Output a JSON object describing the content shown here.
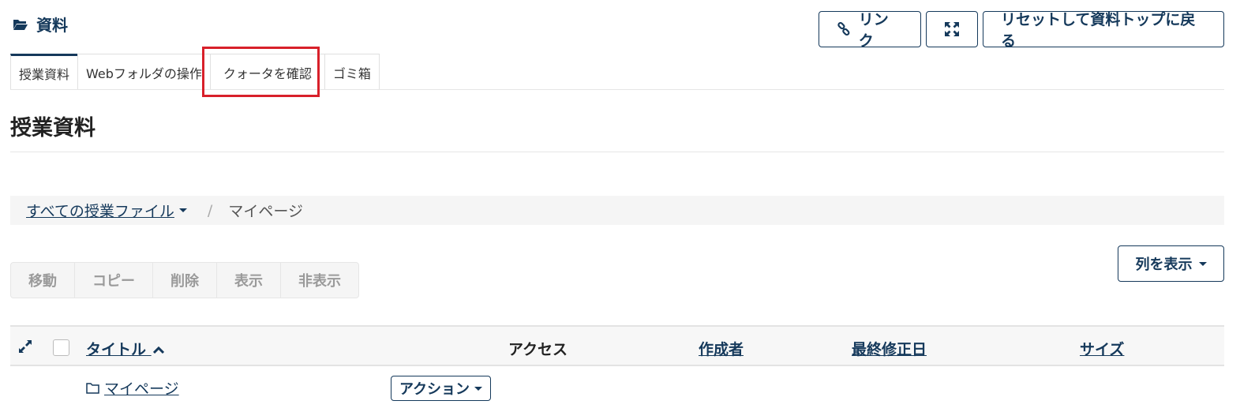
{
  "header": {
    "title": "資料",
    "icon": "folder-open-icon"
  },
  "top_actions": {
    "link_label": "リンク",
    "expand_icon": "expand-icon",
    "reset_label": "リセットして資料トップに戻る"
  },
  "tabs": [
    {
      "label": "授業資料",
      "active": true
    },
    {
      "label": "Webフォルダの操作"
    },
    {
      "label": "クォータを確認"
    },
    {
      "label": "ゴミ箱"
    }
  ],
  "section_title": "授業資料",
  "breadcrumb": {
    "root": "すべての授業ファイル",
    "separator": "/",
    "current": "マイページ"
  },
  "toolbar": {
    "move": "移動",
    "copy": "コピー",
    "delete": "削除",
    "show": "表示",
    "hide": "非表示"
  },
  "columns_button": "列を表示",
  "table": {
    "headers": {
      "title": "タイトル",
      "access": "アクセス",
      "creator": "作成者",
      "modified": "最終修正日",
      "size": "サイズ"
    },
    "rows": [
      {
        "title": "マイページ",
        "action": "アクション"
      }
    ]
  },
  "colors": {
    "primary": "#15395b",
    "highlight": "#d8202a"
  }
}
